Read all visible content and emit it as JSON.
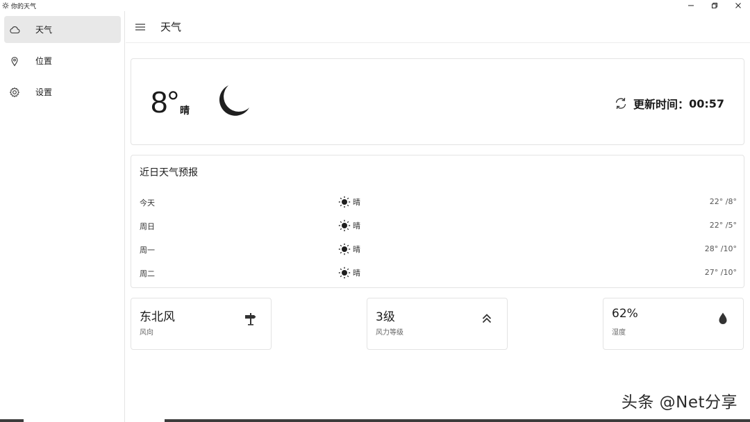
{
  "window": {
    "title": "你的天气",
    "controls": [
      "minimize",
      "restore",
      "close"
    ]
  },
  "sidebar": {
    "items": [
      {
        "label": "天气",
        "icon": "cloud-icon",
        "active": true
      },
      {
        "label": "位置",
        "icon": "location-pin-icon",
        "active": false
      },
      {
        "label": "设置",
        "icon": "gear-icon",
        "active": false
      }
    ]
  },
  "header": {
    "title": "天气"
  },
  "current": {
    "temperature": "8°",
    "condition": "晴",
    "icon": "moon-icon",
    "update_label": "更新时间：",
    "update_time": "00:57"
  },
  "forecast": {
    "title": "近日天气预报",
    "rows": [
      {
        "day": "今天",
        "condition": "晴",
        "temp": "22° /8°"
      },
      {
        "day": "周日",
        "condition": "晴",
        "temp": "22° /5°"
      },
      {
        "day": "周一",
        "condition": "晴",
        "temp": "28° /10°"
      },
      {
        "day": "周二",
        "condition": "晴",
        "temp": "27° /10°"
      }
    ]
  },
  "stats": {
    "wind_direction": {
      "value": "东北风",
      "label": "风向",
      "icon": "signpost-icon"
    },
    "wind_level": {
      "value": "3级",
      "label": "风力等级",
      "icon": "double-chevron-up-icon"
    },
    "humidity": {
      "value": "62%",
      "label": "湿度",
      "icon": "water-drop-icon"
    }
  },
  "watermark": "头条 @Net分享",
  "colors": {
    "active_nav": "#e8e8e8",
    "border": "#e3e3e3",
    "text": "#1b1b1b"
  }
}
